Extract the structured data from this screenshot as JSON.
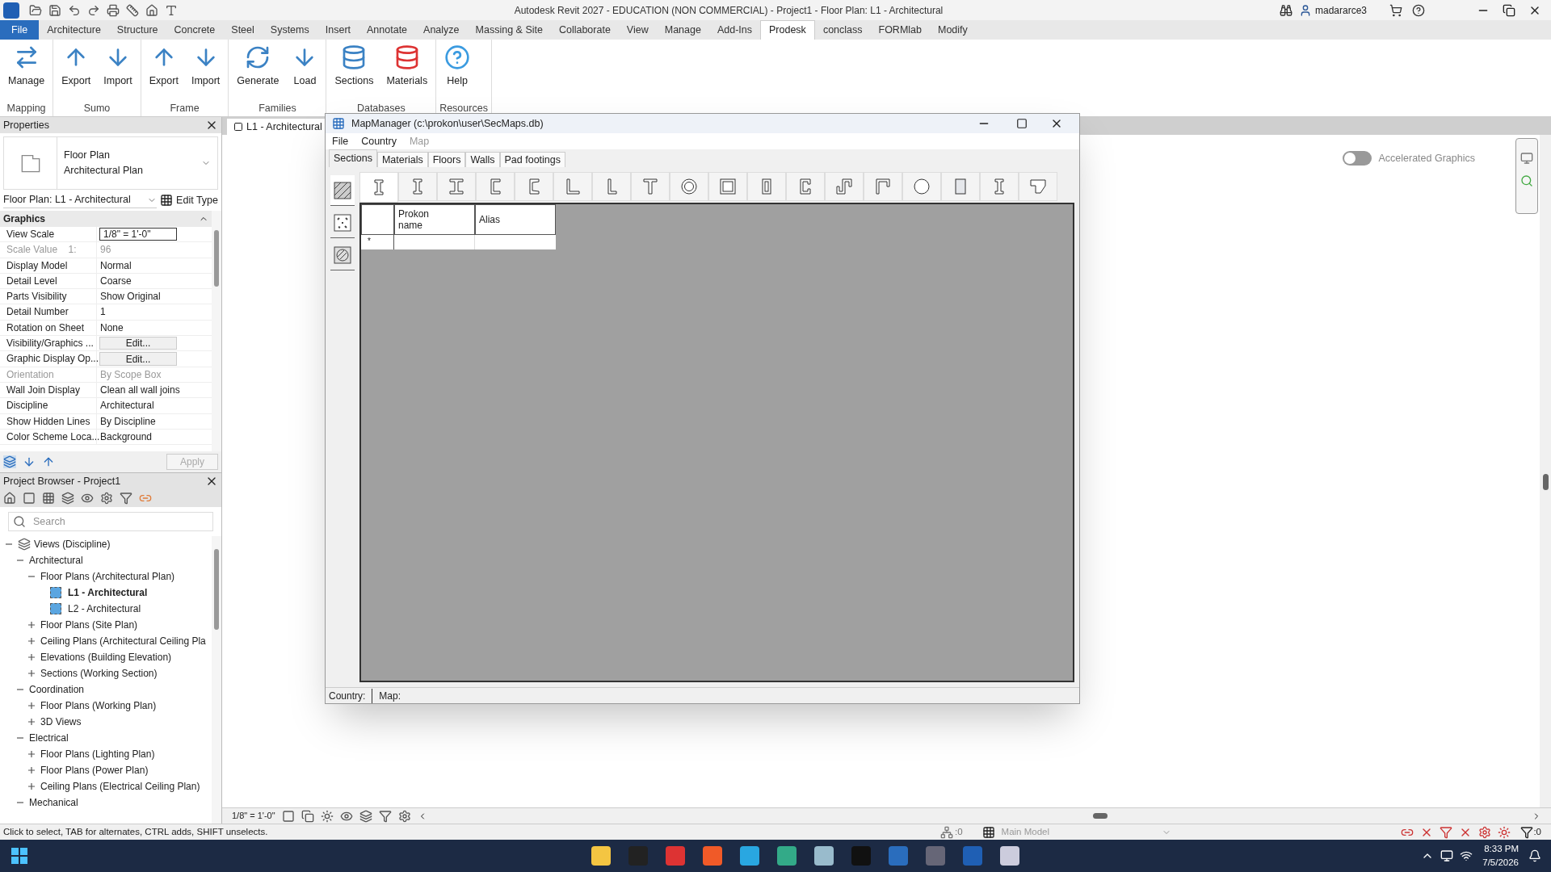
{
  "window": {
    "title": "Autodesk Revit 2027 - EDUCATION (NON COMMERCIAL) - Project1 - Floor Plan: L1 - Architectural",
    "user": "madararce3"
  },
  "ribbon_tabs": [
    {
      "label": "File",
      "kind": "file",
      "selected": false
    },
    {
      "label": "Architecture",
      "kind": "tab",
      "selected": false
    },
    {
      "label": "Structure",
      "kind": "tab",
      "selected": false
    },
    {
      "label": "Concrete",
      "kind": "tab",
      "selected": false
    },
    {
      "label": "Steel",
      "kind": "tab",
      "selected": false
    },
    {
      "label": "Systems",
      "kind": "tab",
      "selected": false
    },
    {
      "label": "Insert",
      "kind": "tab",
      "selected": false
    },
    {
      "label": "Annotate",
      "kind": "tab",
      "selected": false
    },
    {
      "label": "Analyze",
      "kind": "tab",
      "selected": false
    },
    {
      "label": "Massing & Site",
      "kind": "tab",
      "selected": false
    },
    {
      "label": "Collaborate",
      "kind": "tab",
      "selected": false
    },
    {
      "label": "View",
      "kind": "tab",
      "selected": false
    },
    {
      "label": "Manage",
      "kind": "tab",
      "selected": false
    },
    {
      "label": "Add-Ins",
      "kind": "tab",
      "selected": false
    },
    {
      "label": "Prodesk",
      "kind": "tab",
      "selected": true
    },
    {
      "label": "conclass",
      "kind": "tab",
      "selected": false
    },
    {
      "label": "FORMlab",
      "kind": "tab",
      "selected": false
    },
    {
      "label": "Modify",
      "kind": "tab",
      "selected": false
    }
  ],
  "ribbon_panels": [
    {
      "label": "Mapping",
      "buttons": [
        {
          "label": "Manage",
          "kind": "manage"
        }
      ]
    },
    {
      "label": "Sumo",
      "buttons": [
        {
          "label": "Export",
          "kind": "export"
        },
        {
          "label": "Import",
          "kind": "import"
        }
      ]
    },
    {
      "label": "Frame",
      "buttons": [
        {
          "label": "Export",
          "kind": "export"
        },
        {
          "label": "Import",
          "kind": "import"
        }
      ]
    },
    {
      "label": "Families",
      "buttons": [
        {
          "label": "Generate",
          "kind": "generate"
        },
        {
          "label": "Load",
          "kind": "load"
        }
      ]
    },
    {
      "label": "Databases",
      "buttons": [
        {
          "label": "Sections",
          "kind": "sections"
        },
        {
          "label": "Materials",
          "kind": "materials"
        }
      ]
    },
    {
      "label": "Resources",
      "buttons": [
        {
          "label": "Help",
          "kind": "help"
        }
      ]
    }
  ],
  "view_tab": {
    "label": "L1 - Architectural"
  },
  "properties": {
    "title": "Properties",
    "type_name": "Floor Plan",
    "type_subname": "Architectural Plan",
    "instance": "Floor Plan: L1 - Architectural",
    "edit_type": "Edit Type",
    "group": "Graphics",
    "rows": [
      {
        "name": "View Scale",
        "value": "1/8\" = 1'-0\"",
        "kind": "field",
        "disabled": false
      },
      {
        "name": "Scale Value    1:",
        "value": "96",
        "kind": "text",
        "disabled": true
      },
      {
        "name": "Display Model",
        "value": "Normal",
        "kind": "text",
        "disabled": false
      },
      {
        "name": "Detail Level",
        "value": "Coarse",
        "kind": "text",
        "disabled": false
      },
      {
        "name": "Parts Visibility",
        "value": "Show Original",
        "kind": "text",
        "disabled": false
      },
      {
        "name": "Detail Number",
        "value": "1",
        "kind": "text",
        "disabled": false
      },
      {
        "name": "Rotation on Sheet",
        "value": "None",
        "kind": "text",
        "disabled": false
      },
      {
        "name": "Visibility/Graphics ...",
        "value": "Edit...",
        "kind": "button",
        "disabled": false
      },
      {
        "name": "Graphic Display Op...",
        "value": "Edit...",
        "kind": "button",
        "disabled": false
      },
      {
        "name": "Orientation",
        "value": "By Scope Box",
        "kind": "text",
        "disabled": true
      },
      {
        "name": "Wall Join Display",
        "value": "Clean all wall joins",
        "kind": "text",
        "disabled": false
      },
      {
        "name": "Discipline",
        "value": "Architectural",
        "kind": "text",
        "disabled": false
      },
      {
        "name": "Show Hidden Lines",
        "value": "By Discipline",
        "kind": "text",
        "disabled": false
      },
      {
        "name": "Color Scheme Loca...",
        "value": "Background",
        "kind": "text",
        "disabled": false
      }
    ],
    "apply": {
      "label": "Apply",
      "disabled": true
    }
  },
  "project_browser": {
    "title": "Project Browser - Project1",
    "search": {
      "placeholder": "Search"
    },
    "tree": [
      {
        "label": "Views (Discipline)",
        "expanded": true,
        "children": [
          {
            "label": "Architectural",
            "expanded": true,
            "children": [
              {
                "label": "Floor Plans (Architectural Plan)",
                "expanded": true,
                "children": [
                  {
                    "label": "L1 - Architectural",
                    "kind": "view",
                    "selected": true
                  },
                  {
                    "label": "L2 - Architectural",
                    "kind": "view",
                    "selected": false
                  }
                ]
              },
              {
                "label": "Floor Plans (Site Plan)",
                "expanded": false
              },
              {
                "label": "Ceiling Plans (Architectural Ceiling Pla",
                "expanded": false
              },
              {
                "label": "Elevations (Building Elevation)",
                "expanded": false
              },
              {
                "label": "Sections (Working Section)",
                "expanded": false
              }
            ]
          },
          {
            "label": "Coordination",
            "expanded": true,
            "children": [
              {
                "label": "Floor Plans (Working Plan)",
                "expanded": false
              },
              {
                "label": "3D Views",
                "expanded": false
              }
            ]
          },
          {
            "label": "Electrical",
            "expanded": true,
            "children": [
              {
                "label": "Floor Plans (Lighting Plan)",
                "expanded": false
              },
              {
                "label": "Floor Plans (Power Plan)",
                "expanded": false
              },
              {
                "label": "Ceiling Plans (Electrical Ceiling Plan)",
                "expanded": false
              }
            ]
          },
          {
            "label": "Mechanical",
            "expanded": true
          }
        ]
      }
    ]
  },
  "accelerated_graphics": {
    "label": "Accelerated Graphics",
    "on": false
  },
  "dialog": {
    "title": "MapManager (c:\\prokon\\user\\SecMaps.db)",
    "menu": [
      {
        "label": "File",
        "disabled": false
      },
      {
        "label": "Country",
        "disabled": false
      },
      {
        "label": "Map",
        "disabled": true
      }
    ],
    "tabs": [
      {
        "label": "Sections",
        "selected": true
      },
      {
        "label": "Materials",
        "selected": false
      },
      {
        "label": "Floors",
        "selected": false
      },
      {
        "label": "Walls",
        "selected": false
      },
      {
        "label": "Pad footings",
        "selected": false
      }
    ],
    "side_tools": [
      {
        "kind": "hatch",
        "selected": true
      },
      {
        "kind": "points",
        "selected": false
      },
      {
        "kind": "material",
        "selected": false
      }
    ],
    "shapes": [
      {
        "kind": "i",
        "selected": true
      },
      {
        "kind": "i",
        "selected": false
      },
      {
        "kind": "i-wide",
        "selected": false
      },
      {
        "kind": "channel",
        "selected": false
      },
      {
        "kind": "channel-tapered",
        "selected": false
      },
      {
        "kind": "angle",
        "selected": false
      },
      {
        "kind": "angle-small",
        "selected": false
      },
      {
        "kind": "tee",
        "selected": false
      },
      {
        "kind": "tube",
        "selected": false
      },
      {
        "kind": "box",
        "selected": false
      },
      {
        "kind": "box-narrow",
        "selected": false
      },
      {
        "kind": "lipped-channel",
        "selected": false
      },
      {
        "kind": "z",
        "selected": false
      },
      {
        "kind": "lipped-angle",
        "selected": false
      },
      {
        "kind": "round",
        "selected": false
      },
      {
        "kind": "plate",
        "selected": false
      },
      {
        "kind": "i",
        "selected": false
      },
      {
        "kind": "bulb",
        "selected": false
      }
    ],
    "grid": {
      "columns": [
        "Prokon name",
        "Alias"
      ],
      "new_row_marker": "*"
    },
    "status": [
      "Country:",
      "Map:"
    ]
  },
  "view_bar": {
    "scale": "1/8\" = 1'-0\""
  },
  "status_bar": {
    "message": "Click to select, TAB for alternates, CTRL adds, SHIFT unselects.",
    "workset_count": ":0",
    "model": "Main Model",
    "filter_count": ":0"
  },
  "taskbar": {
    "time": "8:33 PM",
    "date": "7/5/2026"
  }
}
